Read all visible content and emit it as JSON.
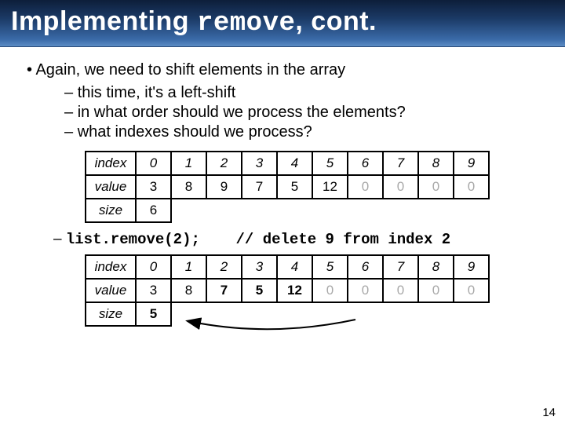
{
  "title": {
    "pre": "Implementing ",
    "code": "remove",
    "post": ", cont."
  },
  "bullets": {
    "l1": "Again, we need to shift elements in the array",
    "subs": [
      "this time, it's a left-shift",
      "in what order should we process the elements?",
      "what indexes should we process?"
    ]
  },
  "table_labels": {
    "index": "index",
    "value": "value",
    "size": "size"
  },
  "table_before": {
    "indexes": [
      "0",
      "1",
      "2",
      "3",
      "4",
      "5",
      "6",
      "7",
      "8",
      "9"
    ],
    "values": [
      "3",
      "8",
      "9",
      "7",
      "5",
      "12",
      "0",
      "0",
      "0",
      "0"
    ],
    "gray_from": 6,
    "bold_cols": [],
    "size": "6",
    "size_bold": false
  },
  "code_line": {
    "call": "list.remove(2);",
    "comment": "// delete 9 from index 2"
  },
  "table_after": {
    "indexes": [
      "0",
      "1",
      "2",
      "3",
      "4",
      "5",
      "6",
      "7",
      "8",
      "9"
    ],
    "values": [
      "3",
      "8",
      "7",
      "5",
      "12",
      "0",
      "0",
      "0",
      "0",
      "0"
    ],
    "gray_from": 5,
    "bold_cols": [
      2,
      3,
      4
    ],
    "size": "5",
    "size_bold": true
  },
  "page": "14"
}
